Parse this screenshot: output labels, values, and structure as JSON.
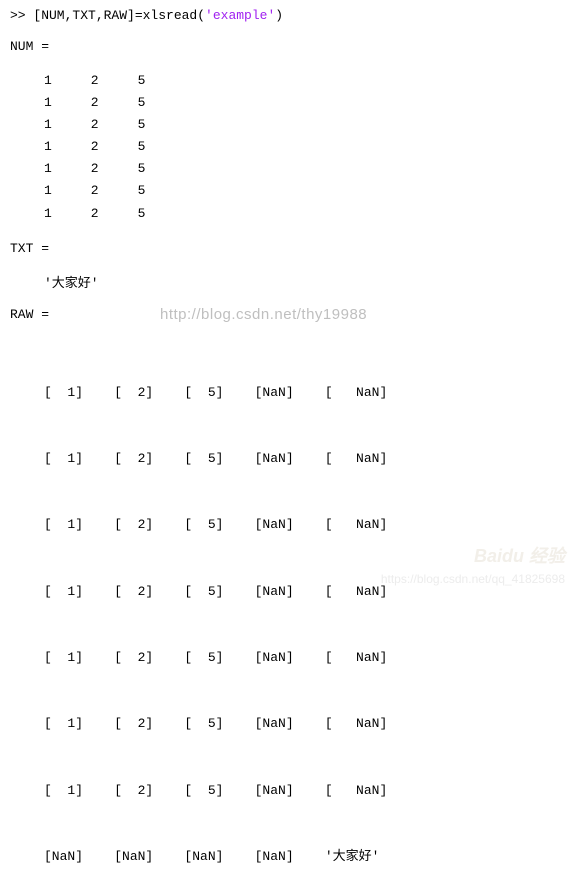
{
  "command": {
    "prompt": ">> ",
    "lhs": "[NUM,TXT,RAW]=",
    "func": "xlsread",
    "open": "(",
    "arg": "'example'",
    "close": ")"
  },
  "num": {
    "label": "NUM =",
    "rows": [
      "1     2     5",
      "1     2     5",
      "1     2     5",
      "1     2     5",
      "1     2     5",
      "1     2     5",
      "1     2     5"
    ]
  },
  "txt": {
    "label": "TXT =",
    "value": "'大家好'"
  },
  "raw": {
    "label": "RAW =",
    "rows": [
      "[  1]    [  2]    [  5]    [NaN]    [   NaN]",
      "[  1]    [  2]    [  5]    [NaN]    [   NaN]",
      "[  1]    [  2]    [  5]    [NaN]    [   NaN]",
      "[  1]    [  2]    [  5]    [NaN]    [   NaN]",
      "[  1]    [  2]    [  5]    [NaN]    [   NaN]",
      "[  1]    [  2]    [  5]    [NaN]    [   NaN]",
      "[  1]    [  2]    [  5]    [NaN]    [   NaN]",
      "[NaN]    [NaN]    [NaN]    [NaN]    '大家好'"
    ]
  },
  "watermarks": {
    "center": "http://blog.csdn.net/thy19988",
    "baidu": "Baidu 经验",
    "csdn": "https://blog.csdn.net/qq_41825698"
  }
}
